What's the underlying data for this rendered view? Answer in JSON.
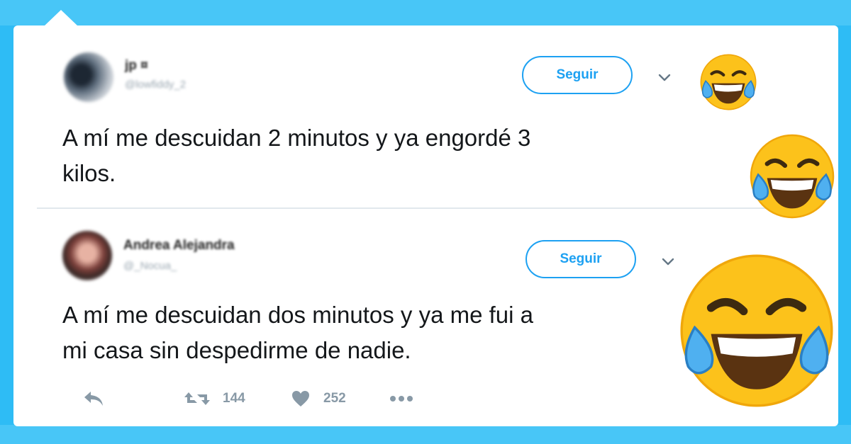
{
  "tweets": [
    {
      "author_name": "jp ¤",
      "author_handle": "@lowfiddy_2",
      "follow_label": "Seguir",
      "text_line1": "A mí me descuidan 2 minutos y ya engordé 3",
      "text_line2": "kilos."
    },
    {
      "author_name": "Andrea Alejandra",
      "author_handle": "@_Nocua_",
      "follow_label": "Seguir",
      "text_line1": "A mí me descuidan dos minutos y ya me fui a",
      "text_line2": "mi casa sin despedirme de nadie.",
      "retweets": "144",
      "likes": "252"
    }
  ],
  "colors": {
    "background": "#2ebcf5",
    "accent": "#1da1f2",
    "text": "#14171a",
    "muted": "#8899a6"
  },
  "icons": [
    "chevron-down-icon",
    "reply-icon",
    "retweet-icon",
    "heart-icon",
    "more-icon",
    "laughing-emoji"
  ]
}
